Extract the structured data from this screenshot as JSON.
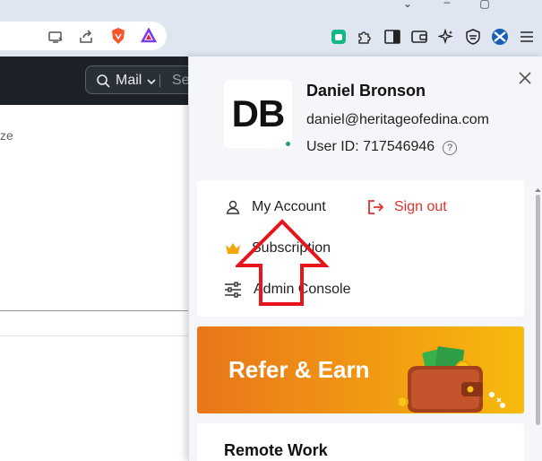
{
  "browser": {
    "window_controls": [
      "chevron-down-icon",
      "minimize-icon",
      "maximize-icon"
    ],
    "toolbar_icons": [
      "install-app-icon",
      "share-icon",
      "brave-shields-icon",
      "brave-rewards-icon",
      "zoho-extension-icon",
      "extensions-icon",
      "sidebar-icon",
      "wallet-icon",
      "leo-ai-icon",
      "vpn-shield-icon",
      "profile-icon",
      "menu-icon"
    ]
  },
  "app": {
    "search_scope": "Mail",
    "search_placeholder_fragment": "Se",
    "partial_text": "ze"
  },
  "profile": {
    "initials": "DB",
    "name": "Daniel Bronson",
    "email": "daniel@heritageofedina.com",
    "user_id": "User ID: 717546946",
    "help_glyph": "?",
    "status_color": "#1ea465"
  },
  "menu": {
    "my_account": "My Account",
    "sign_out": "Sign out",
    "subscription": "Subscription",
    "admin_console": "Admin Console"
  },
  "banner": {
    "text": "Refer & Earn"
  },
  "section": {
    "title": "Remote Work"
  },
  "colors": {
    "accent_red": "#e0312d",
    "annotation_arrow": "#e8141b",
    "banner_start": "#e8761a",
    "banner_end": "#f6bb0e",
    "appbar": "#1c2228"
  }
}
